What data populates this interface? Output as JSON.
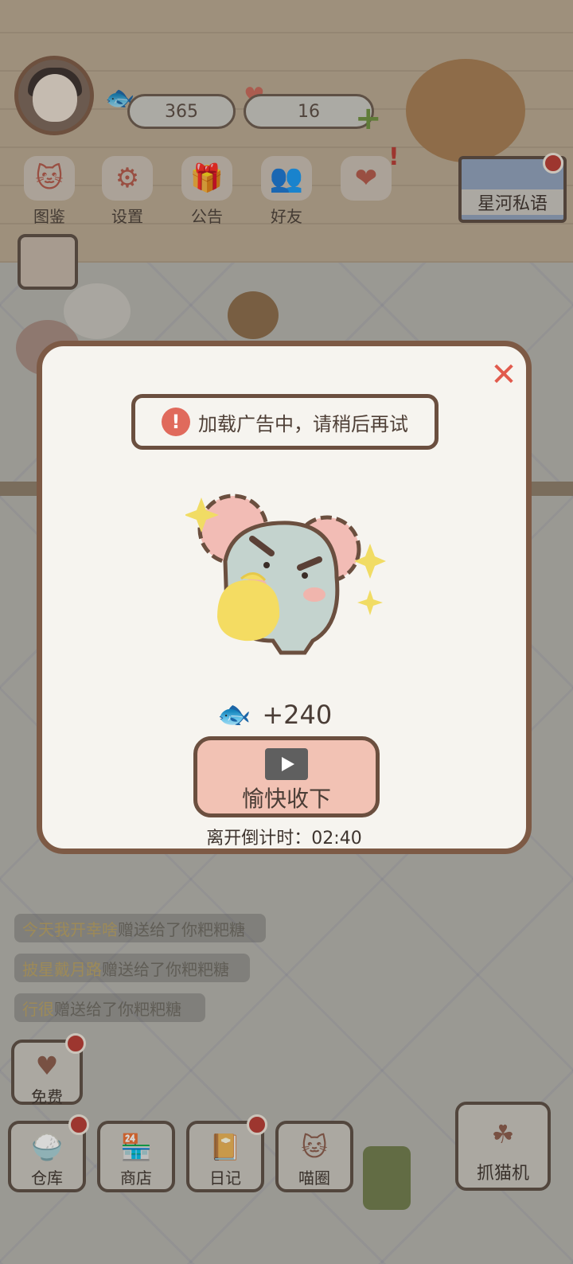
{
  "top": {
    "fish_count": "365",
    "heart_count": "16",
    "menu": [
      {
        "label": "图鉴",
        "icon": "cat-face-icon"
      },
      {
        "label": "设置",
        "icon": "gear-icon"
      },
      {
        "label": "公告",
        "icon": "gift-icon"
      },
      {
        "label": "好友",
        "icon": "friends-icon"
      }
    ],
    "star_river_label": "星河私语"
  },
  "chat": [
    {
      "name": "今天我开幸啥",
      "text": "赠送给了你粑粑糖"
    },
    {
      "name": "披星戴月路",
      "text": "赠送给了你粑粑糖"
    },
    {
      "name": "行很",
      "text": "赠送给了你粑粑糖"
    }
  ],
  "free_label": "免费",
  "bottom_nav": [
    {
      "label": "仓库",
      "icon": "storage-icon"
    },
    {
      "label": "商店",
      "icon": "shop-icon"
    },
    {
      "label": "日记",
      "icon": "diary-icon"
    },
    {
      "label": "喵圈",
      "icon": "cat-planet-icon"
    }
  ],
  "claw_machine_label": "抓猫机",
  "modal": {
    "toast": "加载广告中，请稍后再试",
    "reward_amount": "+240",
    "claim_label": "愉快收下",
    "countdown": "离开倒计时：02:40"
  },
  "colors": {
    "accent": "#e15a4c",
    "button": "#f2c2b4",
    "border": "#7d5a45"
  }
}
